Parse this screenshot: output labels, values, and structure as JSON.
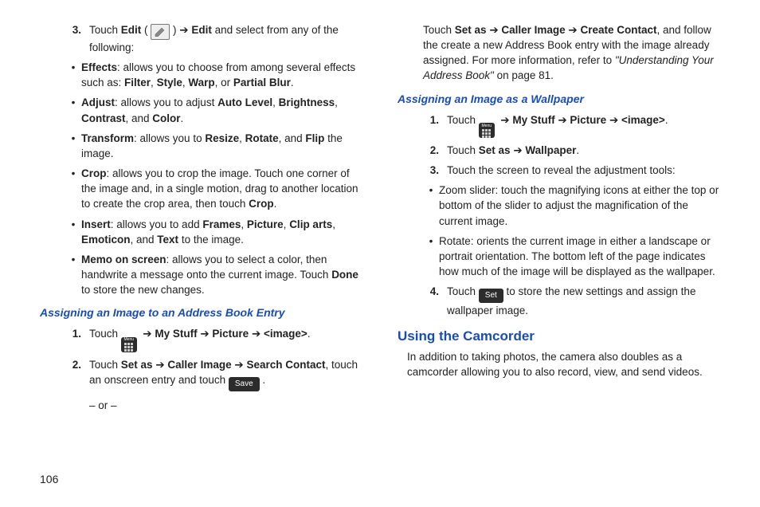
{
  "pageNumber": "106",
  "left": {
    "step3": {
      "num": "3.",
      "pre": "Touch ",
      "edit": "Edit",
      "paren_open": " ( ",
      "paren_close": " ) ",
      "arrow": "➔",
      "edit2": " Edit",
      "tail": " and select from any of the following:"
    },
    "bullets": {
      "effects": {
        "label": "Effects",
        "text": ": allows you to choose from among several effects such as: ",
        "b1": "Filter",
        "b2": "Style",
        "b3": "Warp",
        "or": ", or ",
        "b4": "Partial Blur",
        "end": "."
      },
      "adjust": {
        "label": "Adjust",
        "text": ": allows you to adjust ",
        "b1": "Auto Level",
        "b2": "Brightness",
        "b3": "Contrast",
        "and": ", and ",
        "b4": "Color",
        "end": "."
      },
      "transform": {
        "label": "Transform",
        "text": ": allows you to ",
        "b1": "Resize",
        "b2": "Rotate",
        "and": ", and ",
        "b3": "Flip",
        "end": " the image."
      },
      "crop": {
        "label": "Crop",
        "text": ": allows you to crop the image. Touch one corner of the image and, in a single motion, drag to another location to create the crop area, then touch ",
        "b1": "Crop",
        "end": "."
      },
      "insert": {
        "label": "Insert",
        "text": ": allows you to add ",
        "b1": "Frames",
        "b2": "Picture",
        "b3": "Clip arts",
        "b4": "Emoticon",
        "and": ", and ",
        "b5": "Text",
        "end": " to the image."
      },
      "memo": {
        "label": "Memo on screen",
        "text": ": allows you to select a color, then handwrite a message onto the current image. Touch ",
        "b1": "Done",
        "end": " to store the new changes."
      }
    },
    "h3": "Assigning an Image to an Address Book Entry",
    "ab1": {
      "num": "1.",
      "pre": "Touch  ",
      "arrow": "➔",
      "b1": " My Stuff ",
      "b2": " Picture ",
      "b3": " <image>",
      "end": "."
    },
    "ab2": {
      "num": "2.",
      "pre": "Touch ",
      "b1": "Set as ",
      "arrow": "➔",
      "b2": " Caller Image ",
      "b3": " Search Contact",
      "mid": ", touch an onscreen entry and touch  ",
      "saveLabel": "Save",
      "end": " .",
      "or": "– or –"
    }
  },
  "right": {
    "cont": {
      "pre": "Touch ",
      "b1": "Set as ",
      "arrow": "➔",
      "b2": " Caller Image ",
      "b3": " Create Contact",
      "mid": ", and follow the create a new Address Book entry with the image already assigned. For more information, refer to ",
      "ref": "\"Understanding Your Address Book\"",
      "end": "  on page 81."
    },
    "h3": "Assigning an Image as a Wallpaper",
    "wp1": {
      "num": "1.",
      "pre": "Touch  ",
      "arrow": "➔",
      "b1": " My Stuff ",
      "b2": " Picture ",
      "b3": " <image>",
      "end": "."
    },
    "wp2": {
      "num": "2.",
      "pre": "Touch ",
      "b1": "Set as ",
      "arrow": "➔",
      "b2": " Wallpaper",
      "end": "."
    },
    "wp3": {
      "num": "3.",
      "text": "Touch the screen to reveal the adjustment tools:"
    },
    "wpBullets": {
      "zoom": "Zoom slider: touch the magnifying icons at either the top or bottom of the slider to adjust the magnification of the current image.",
      "rotate": "Rotate: orients the current image in either a landscape or portrait orientation. The bottom left of the page indicates how much of the image will be displayed as the wallpaper."
    },
    "wp4": {
      "num": "4.",
      "pre": "Touch  ",
      "setLabel": "Set",
      "mid": "  to store the new settings and assign the wallpaper image."
    },
    "h2": "Using the Camcorder",
    "camcorder": "In addition to taking photos, the camera also doubles as a camcorder allowing you to also record, view, and send videos."
  },
  "icons": {
    "menuLabel": "Menu",
    "saveLabel": "Save",
    "setLabel": "Set"
  }
}
